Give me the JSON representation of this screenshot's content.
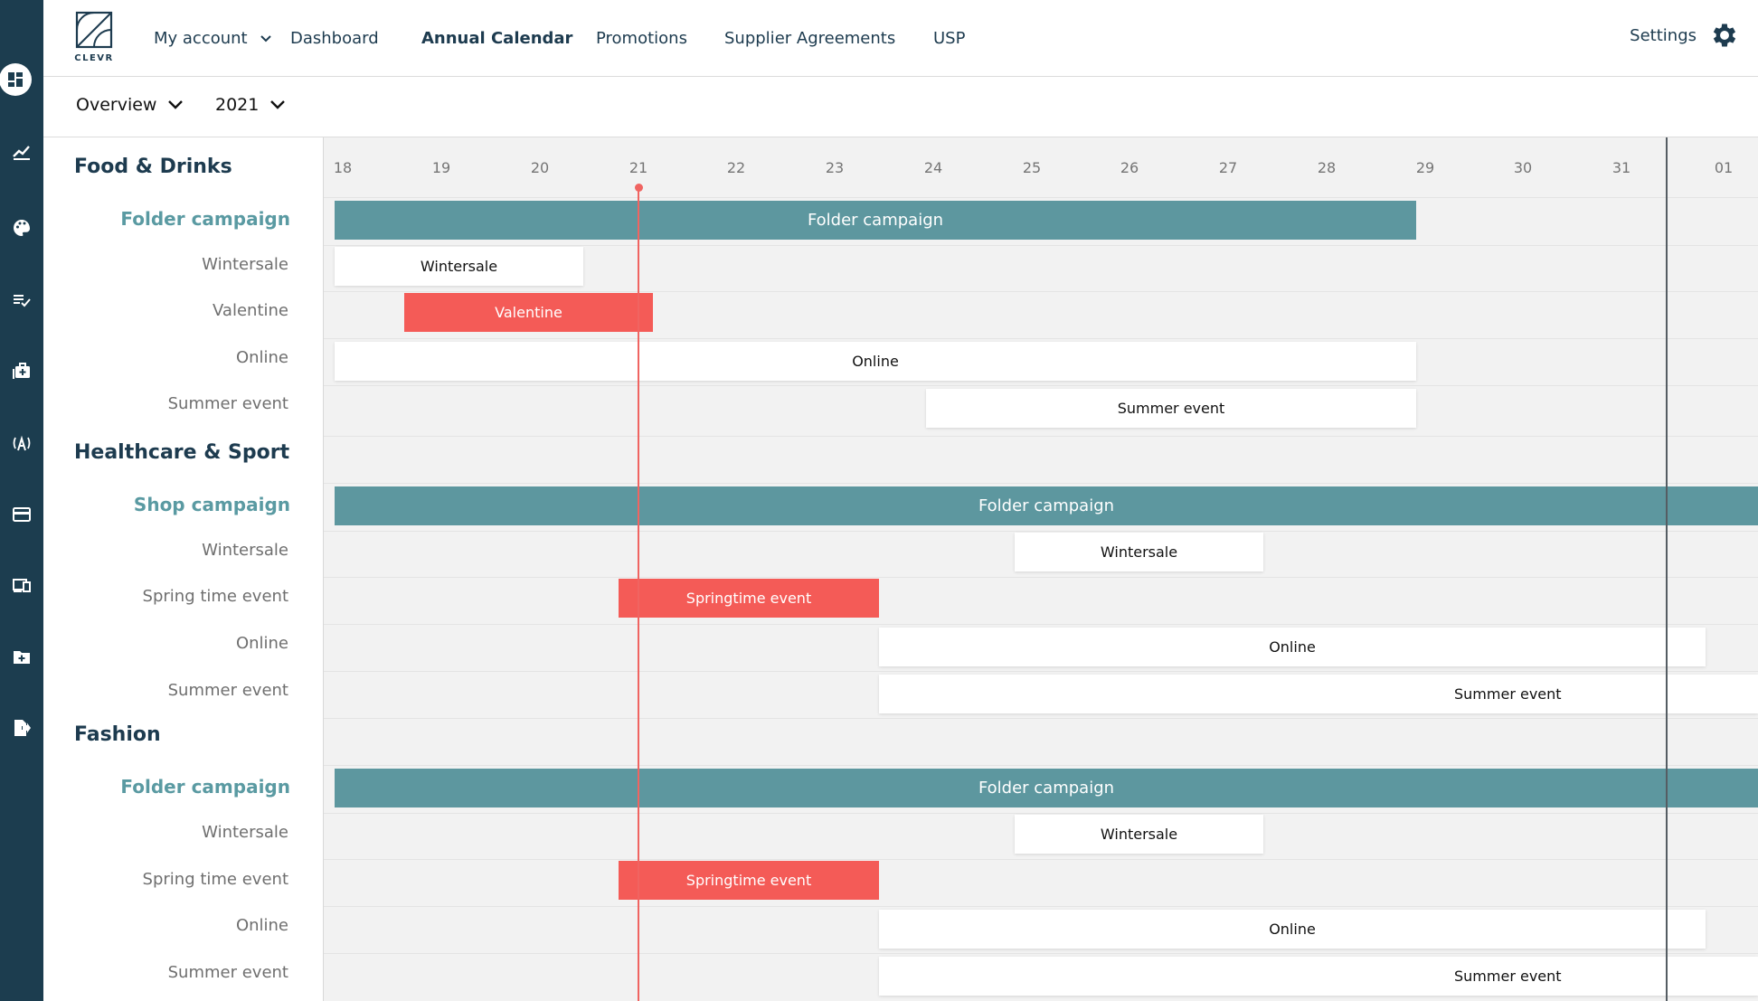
{
  "app": {
    "logo_text": "CLEVR"
  },
  "nav": {
    "my_account": "My account",
    "dashboard": "Dashboard",
    "annual_calendar": "Annual Calendar",
    "promotions": "Promotions",
    "supplier_agreements": "Supplier Agreements",
    "usp": "USP",
    "settings": "Settings"
  },
  "filters": {
    "view": "Overview",
    "year": "2021"
  },
  "sidebar": {
    "icons": [
      "dashboard-icon",
      "chart-line-icon",
      "palette-icon",
      "checklist-icon",
      "briefcase-plus-icon",
      "broadcast-icon",
      "credit-card-icon",
      "devices-icon",
      "folder-plus-icon",
      "logout-icon"
    ]
  },
  "timeline": {
    "days": [
      "18",
      "19",
      "20",
      "21",
      "22",
      "23",
      "24",
      "25",
      "26",
      "27",
      "28",
      "29",
      "30",
      "31",
      "01"
    ],
    "today": "21"
  },
  "categories": [
    {
      "title": "Food & Drinks",
      "campaign_label": "Folder campaign",
      "campaign_bar": "Folder campaign",
      "rows": [
        {
          "label": "Wintersale",
          "bar": "Wintersale"
        },
        {
          "label": "Valentine",
          "bar": "Valentine"
        },
        {
          "label": "Online",
          "bar": "Online"
        },
        {
          "label": "Summer event",
          "bar": "Summer event"
        }
      ]
    },
    {
      "title": "Healthcare & Sport",
      "campaign_label": "Shop campaign",
      "campaign_bar": "Folder campaign",
      "rows": [
        {
          "label": "Wintersale",
          "bar": "Wintersale"
        },
        {
          "label": "Spring time event",
          "bar": "Springtime event"
        },
        {
          "label": "Online",
          "bar": "Online"
        },
        {
          "label": "Summer event",
          "bar": "Summer event"
        }
      ]
    },
    {
      "title": "Fashion",
      "campaign_label": "Folder campaign",
      "campaign_bar": "Folder campaign",
      "rows": [
        {
          "label": "Wintersale",
          "bar": "Wintersale"
        },
        {
          "label": "Spring time event",
          "bar": "Springtime event"
        },
        {
          "label": "Online",
          "bar": "Online"
        },
        {
          "label": "Summer event",
          "bar": "Summer event"
        }
      ]
    }
  ],
  "colors": {
    "sidebar": "#1c3d4f",
    "campaign_bar": "#5d979f",
    "event_red": "#f45b57",
    "today_line": "#f06461",
    "heading": "#1d3b4f"
  }
}
